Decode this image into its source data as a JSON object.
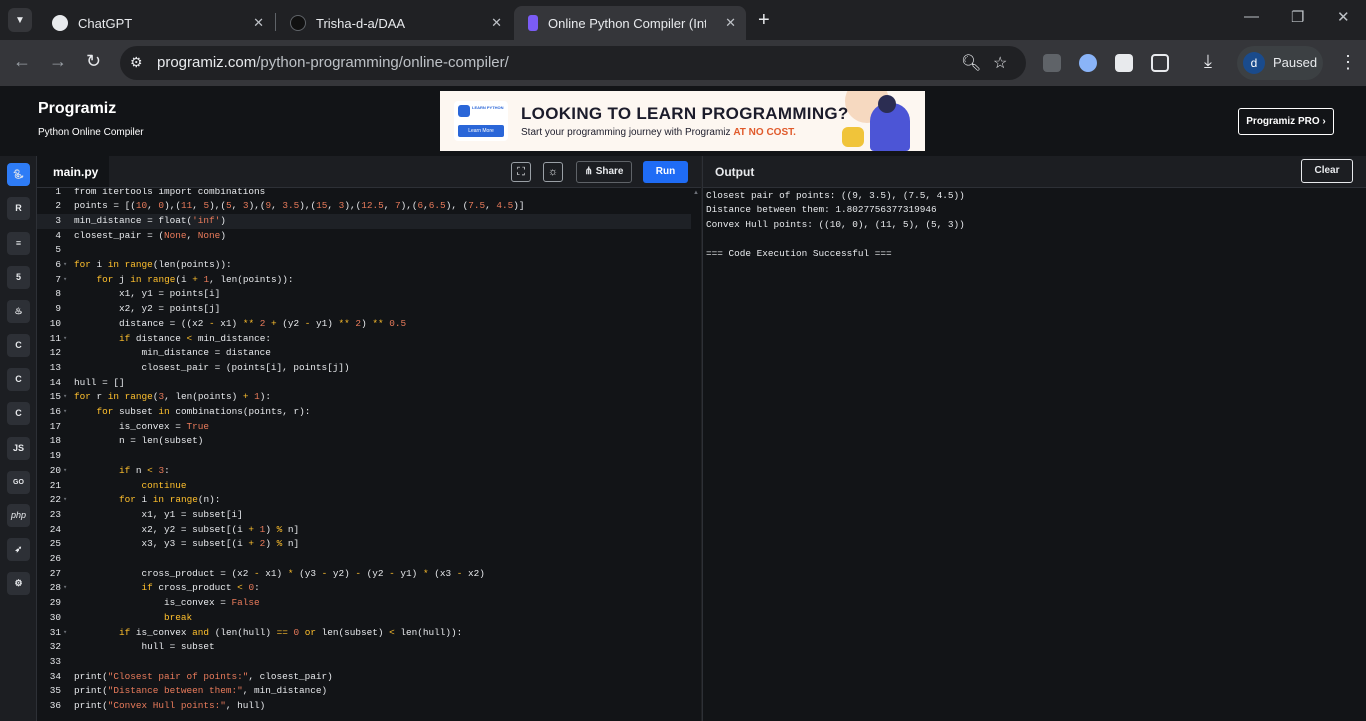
{
  "browser": {
    "tabs": [
      {
        "title": "ChatGPT",
        "active": false
      },
      {
        "title": "Trisha-d-a/DAA",
        "active": false
      },
      {
        "title": "Online Python Compiler (Interpreter)",
        "active": true
      }
    ],
    "url_host": "programiz.com",
    "url_path": "/python-programming/online-compiler/",
    "profile_initial": "d",
    "profile_status": "Paused"
  },
  "site": {
    "logo": "Programiz",
    "subtitle": "Python Online Compiler",
    "banner_badge": "LEARN PYTHON",
    "banner_button": "Learn More",
    "banner_headline": "LOOKING TO LEARN PROGRAMMING?",
    "banner_sub": "Start your programming journey with Programiz",
    "banner_highlight": "AT NO COST.",
    "pro_button": "Programiz PRO ›"
  },
  "languages": [
    "python",
    "r",
    "sql",
    "html",
    "java",
    "c",
    "cpp",
    "csharp",
    "JS",
    "GO",
    "php",
    "swift",
    "rust"
  ],
  "editor": {
    "file_name": "main.py",
    "share_label": "Share",
    "run_label": "Run",
    "lines": [
      [
        [
          "plain",
          "from "
        ],
        [
          "plain",
          "itertools "
        ],
        [
          "plain",
          "import "
        ],
        [
          "plain",
          "combinations"
        ]
      ],
      [
        [
          "plain",
          "points = [("
        ],
        [
          "n",
          "10"
        ],
        [
          "plain",
          ", "
        ],
        [
          "n",
          "0"
        ],
        [
          "plain",
          "),("
        ],
        [
          "n",
          "11"
        ],
        [
          "plain",
          ", "
        ],
        [
          "n",
          "5"
        ],
        [
          "plain",
          "),("
        ],
        [
          "n",
          "5"
        ],
        [
          "plain",
          ", "
        ],
        [
          "n",
          "3"
        ],
        [
          "plain",
          "),("
        ],
        [
          "n",
          "9"
        ],
        [
          "plain",
          ", "
        ],
        [
          "n",
          "3.5"
        ],
        [
          "plain",
          "),("
        ],
        [
          "n",
          "15"
        ],
        [
          "plain",
          ", "
        ],
        [
          "n",
          "3"
        ],
        [
          "plain",
          "),("
        ],
        [
          "n",
          "12.5"
        ],
        [
          "plain",
          ", "
        ],
        [
          "n",
          "7"
        ],
        [
          "plain",
          "),("
        ],
        [
          "n",
          "6"
        ],
        [
          "plain",
          ","
        ],
        [
          "n",
          "6.5"
        ],
        [
          "plain",
          "), ("
        ],
        [
          "n",
          "7.5"
        ],
        [
          "plain",
          ", "
        ],
        [
          "n",
          "4.5"
        ],
        [
          "plain",
          ")]"
        ]
      ],
      [
        [
          "plain",
          "min_distance = float("
        ],
        [
          "s",
          "'inf'"
        ],
        [
          "plain",
          ")"
        ]
      ],
      [
        [
          "plain",
          "closest_pair = ("
        ],
        [
          "s",
          "None"
        ],
        [
          "plain",
          ", "
        ],
        [
          "s",
          "None"
        ],
        [
          "plain",
          ")"
        ]
      ],
      [],
      [
        [
          "k",
          "for "
        ],
        [
          "plain",
          "i "
        ],
        [
          "k",
          "in "
        ],
        [
          "k",
          "range"
        ],
        [
          "plain",
          "(len(points)):"
        ]
      ],
      [
        [
          "plain",
          "    "
        ],
        [
          "k",
          "for "
        ],
        [
          "plain",
          "j "
        ],
        [
          "k",
          "in "
        ],
        [
          "k",
          "range"
        ],
        [
          "plain",
          "(i "
        ],
        [
          "o",
          "+ "
        ],
        [
          "n",
          "1"
        ],
        [
          "plain",
          ", len(points)):"
        ]
      ],
      [
        [
          "plain",
          "        x1, y1 = points[i]"
        ]
      ],
      [
        [
          "plain",
          "        x2, y2 = points[j]"
        ]
      ],
      [
        [
          "plain",
          "        distance = ((x2 "
        ],
        [
          "o",
          "- "
        ],
        [
          "plain",
          "x1) "
        ],
        [
          "o",
          "** "
        ],
        [
          "n",
          "2 "
        ],
        [
          "o",
          "+ "
        ],
        [
          "plain",
          "(y2 "
        ],
        [
          "o",
          "- "
        ],
        [
          "plain",
          "y1) "
        ],
        [
          "o",
          "** "
        ],
        [
          "n",
          "2"
        ],
        [
          "plain",
          ") "
        ],
        [
          "o",
          "** "
        ],
        [
          "n",
          "0.5"
        ]
      ],
      [
        [
          "plain",
          "        "
        ],
        [
          "k",
          "if "
        ],
        [
          "plain",
          "distance "
        ],
        [
          "o",
          "< "
        ],
        [
          "plain",
          "min_distance:"
        ]
      ],
      [
        [
          "plain",
          "            min_distance = distance"
        ]
      ],
      [
        [
          "plain",
          "            closest_pair = (points[i], points[j])"
        ]
      ],
      [
        [
          "plain",
          "hull = []"
        ]
      ],
      [
        [
          "k",
          "for "
        ],
        [
          "plain",
          "r "
        ],
        [
          "k",
          "in "
        ],
        [
          "k",
          "range"
        ],
        [
          "plain",
          "("
        ],
        [
          "n",
          "3"
        ],
        [
          "plain",
          ", len(points) "
        ],
        [
          "o",
          "+ "
        ],
        [
          "n",
          "1"
        ],
        [
          "plain",
          "):"
        ]
      ],
      [
        [
          "plain",
          "    "
        ],
        [
          "k",
          "for "
        ],
        [
          "plain",
          "subset "
        ],
        [
          "k",
          "in "
        ],
        [
          "plain",
          "combinations(points, r):"
        ]
      ],
      [
        [
          "plain",
          "        is_convex = "
        ],
        [
          "s",
          "True"
        ]
      ],
      [
        [
          "plain",
          "        n = len(subset)"
        ]
      ],
      [],
      [
        [
          "plain",
          "        "
        ],
        [
          "k",
          "if "
        ],
        [
          "plain",
          "n "
        ],
        [
          "o",
          "< "
        ],
        [
          "n",
          "3"
        ],
        [
          "plain",
          ":"
        ]
      ],
      [
        [
          "plain",
          "            "
        ],
        [
          "k",
          "continue"
        ]
      ],
      [
        [
          "plain",
          "        "
        ],
        [
          "k",
          "for "
        ],
        [
          "plain",
          "i "
        ],
        [
          "k",
          "in "
        ],
        [
          "k",
          "range"
        ],
        [
          "plain",
          "(n):"
        ]
      ],
      [
        [
          "plain",
          "            x1, y1 = subset[i]"
        ]
      ],
      [
        [
          "plain",
          "            x2, y2 = subset[(i "
        ],
        [
          "o",
          "+ "
        ],
        [
          "n",
          "1"
        ],
        [
          "plain",
          ") "
        ],
        [
          "o",
          "% "
        ],
        [
          "plain",
          "n]"
        ]
      ],
      [
        [
          "plain",
          "            x3, y3 = subset[(i "
        ],
        [
          "o",
          "+ "
        ],
        [
          "n",
          "2"
        ],
        [
          "plain",
          ") "
        ],
        [
          "o",
          "% "
        ],
        [
          "plain",
          "n]"
        ]
      ],
      [],
      [
        [
          "plain",
          "            cross_product = (x2 "
        ],
        [
          "o",
          "- "
        ],
        [
          "plain",
          "x1) "
        ],
        [
          "o",
          "* "
        ],
        [
          "plain",
          "(y3 "
        ],
        [
          "o",
          "- "
        ],
        [
          "plain",
          "y2) "
        ],
        [
          "o",
          "- "
        ],
        [
          "plain",
          "(y2 "
        ],
        [
          "o",
          "- "
        ],
        [
          "plain",
          "y1) "
        ],
        [
          "o",
          "* "
        ],
        [
          "plain",
          "(x3 "
        ],
        [
          "o",
          "- "
        ],
        [
          "plain",
          "x2)"
        ]
      ],
      [
        [
          "plain",
          "            "
        ],
        [
          "k",
          "if "
        ],
        [
          "plain",
          "cross_product "
        ],
        [
          "o",
          "< "
        ],
        [
          "n",
          "0"
        ],
        [
          "plain",
          ":"
        ]
      ],
      [
        [
          "plain",
          "                is_convex = "
        ],
        [
          "s",
          "False"
        ]
      ],
      [
        [
          "plain",
          "                "
        ],
        [
          "k",
          "break"
        ]
      ],
      [
        [
          "plain",
          "        "
        ],
        [
          "k",
          "if "
        ],
        [
          "plain",
          "is_convex "
        ],
        [
          "k",
          "and "
        ],
        [
          "plain",
          "(len(hull) "
        ],
        [
          "o",
          "== "
        ],
        [
          "n",
          "0 "
        ],
        [
          "k",
          "or "
        ],
        [
          "plain",
          "len(subset) "
        ],
        [
          "o",
          "< "
        ],
        [
          "plain",
          "len(hull)):"
        ]
      ],
      [
        [
          "plain",
          "            hull = subset"
        ]
      ],
      [],
      [
        [
          "plain",
          "print("
        ],
        [
          "s",
          "\"Closest pair of points:\""
        ],
        [
          "plain",
          ", closest_pair)"
        ]
      ],
      [
        [
          "plain",
          "print("
        ],
        [
          "s",
          "\"Distance between them:\""
        ],
        [
          "plain",
          ", min_distance)"
        ]
      ],
      [
        [
          "plain",
          "print("
        ],
        [
          "s",
          "\"Convex Hull points:\""
        ],
        [
          "plain",
          ", hull)"
        ]
      ]
    ],
    "fold_lines": [
      6,
      7,
      11,
      15,
      16,
      20,
      22,
      28,
      31
    ]
  },
  "output": {
    "title": "Output",
    "clear_label": "Clear",
    "lines": [
      "Closest pair of points: ((9, 3.5), (7.5, 4.5))",
      "Distance between them: 1.8027756377319946",
      "Convex Hull points: ((10, 0), (11, 5), (5, 3))",
      "",
      "=== Code Execution Successful ==="
    ]
  },
  "colors": {
    "keyword": "#ffc02d",
    "string": "#e97b5b",
    "run_button": "#1f6cf5",
    "active_lang": "#2e7cf6"
  }
}
